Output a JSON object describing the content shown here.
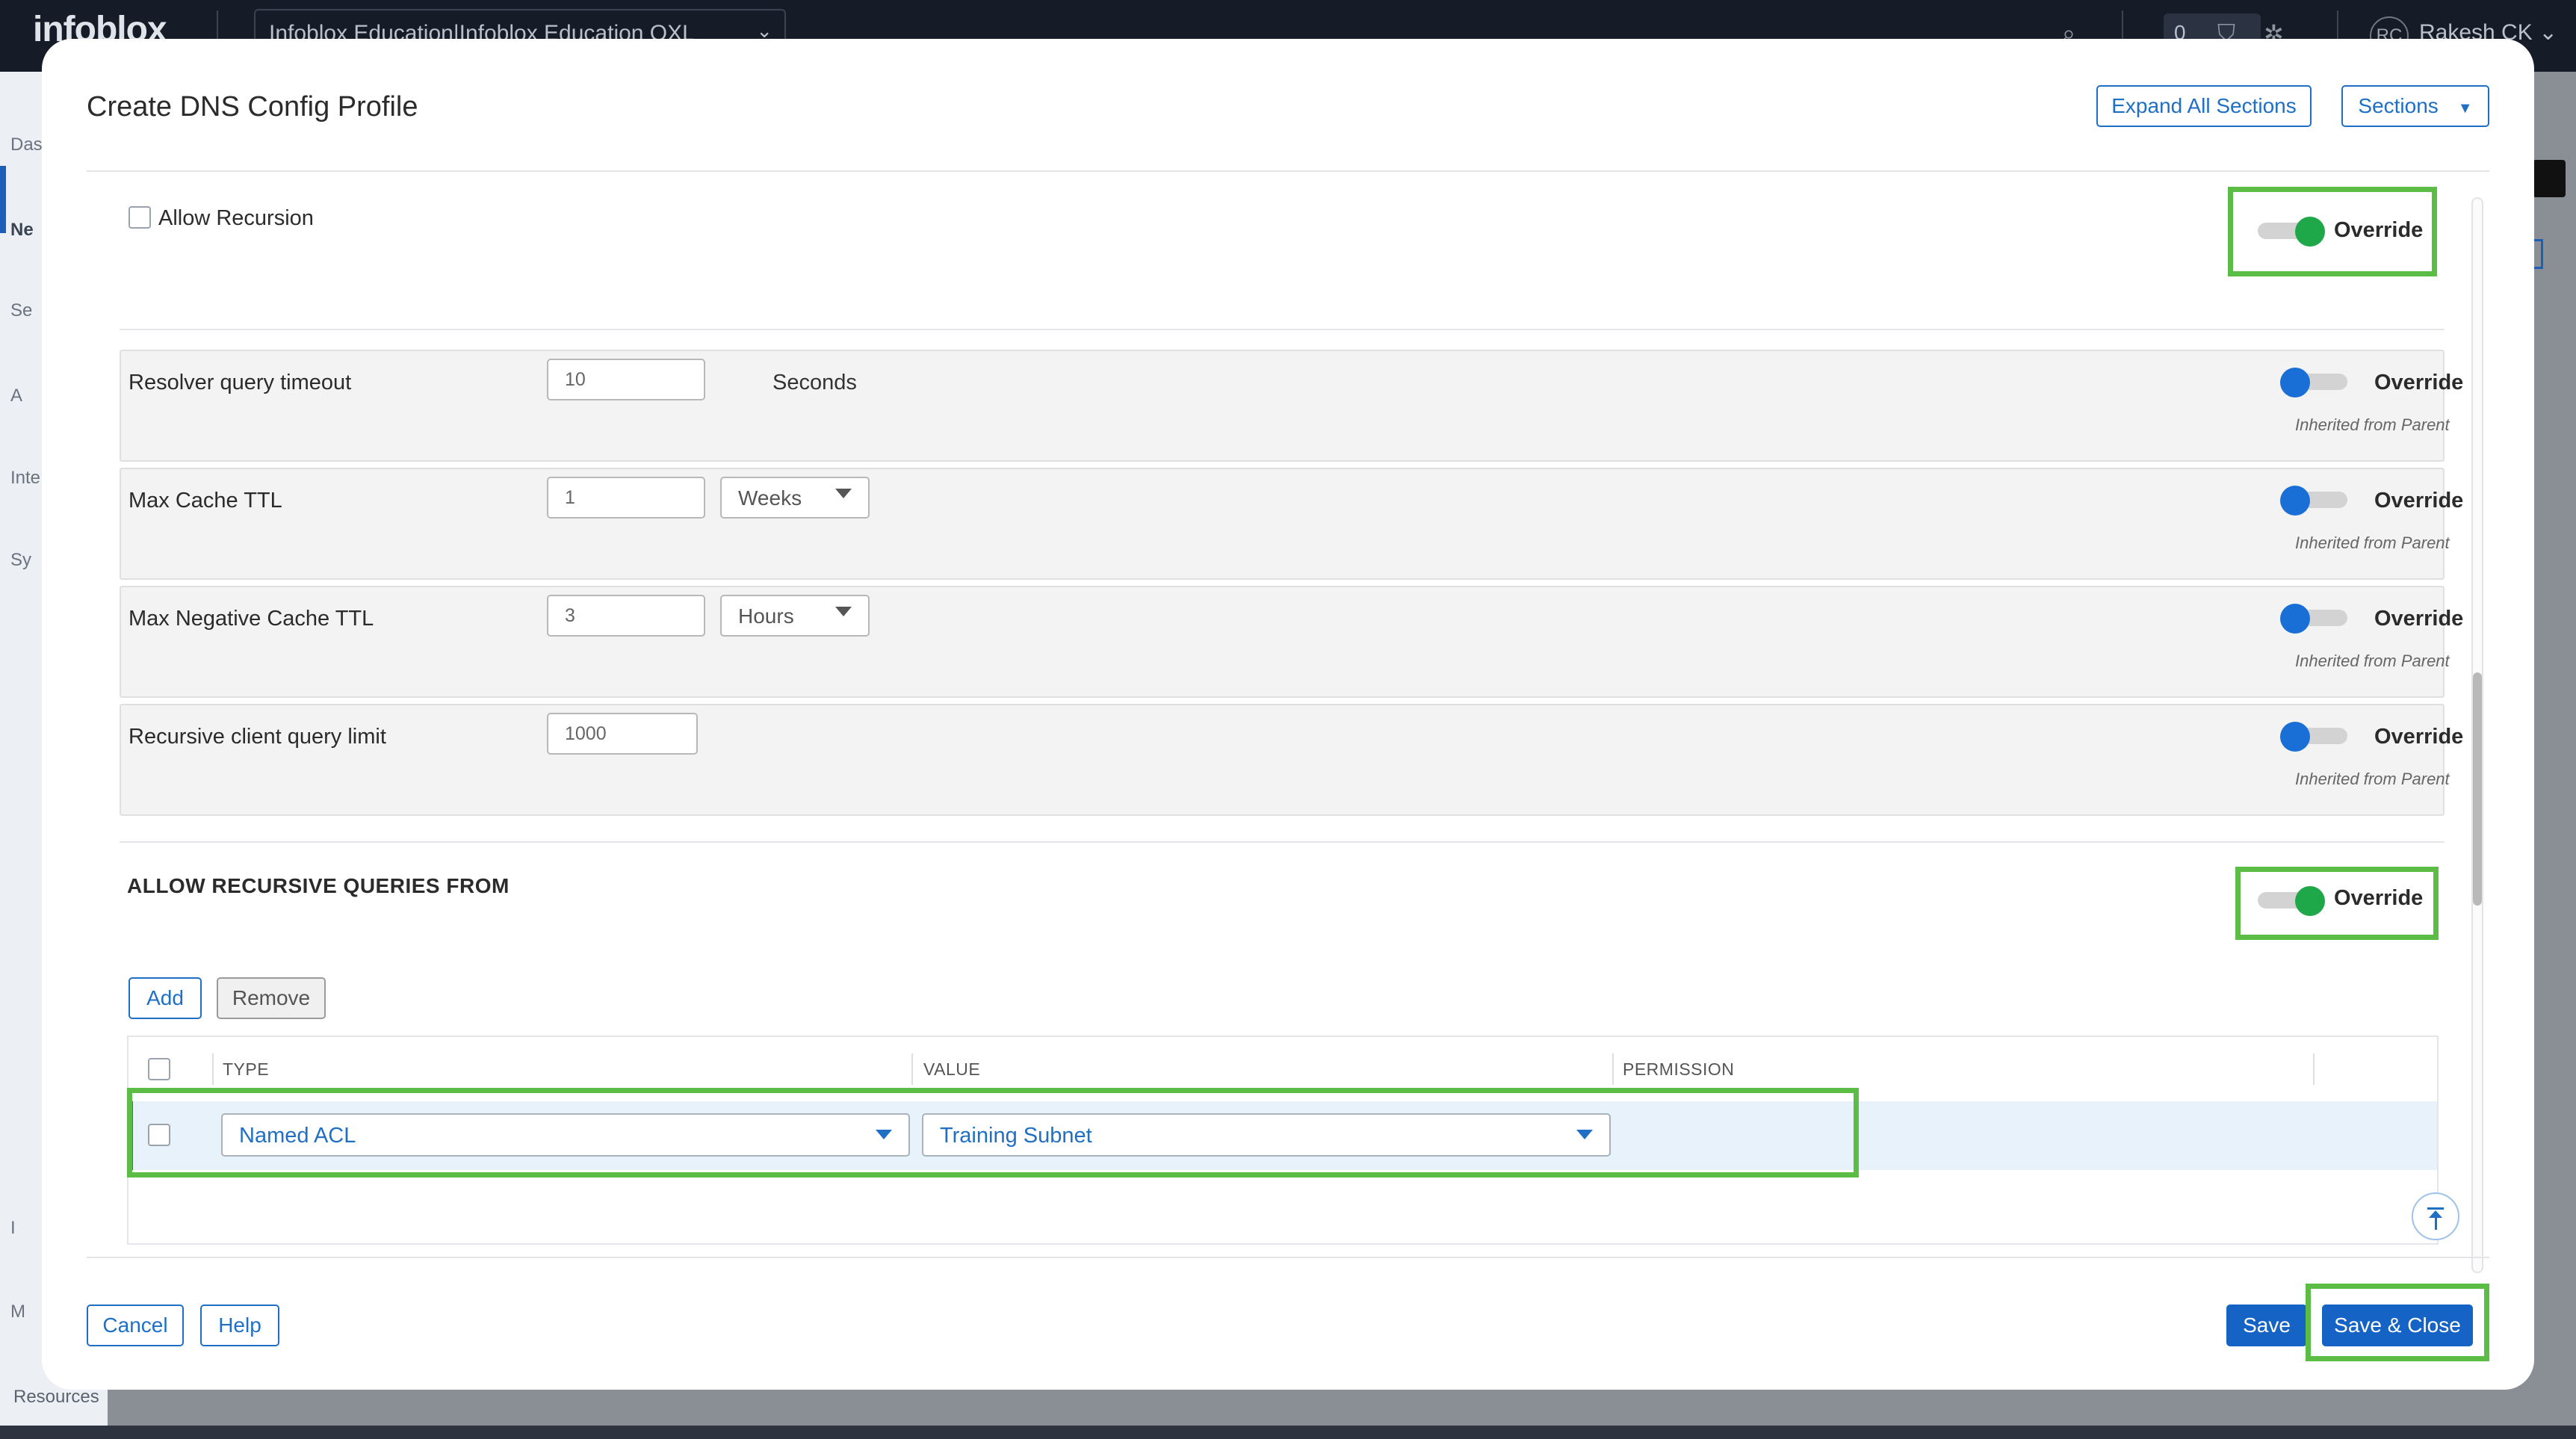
{
  "topbar": {
    "brand": "infoblox",
    "account": "Infoblox Education|Infoblox Education OXL",
    "notifications": "0",
    "user_initials": "RC",
    "user_name": "Rakesh CK"
  },
  "sidebar": {
    "items": [
      "Das",
      "Ne",
      "Se",
      "A",
      "Inte",
      "Sy",
      "I",
      "M"
    ],
    "resources": "Resources"
  },
  "modal": {
    "title": "Create DNS Config Profile",
    "expand_all": "Expand All Sections",
    "sections": "Sections",
    "allow_recursion": {
      "label": "Allow Recursion",
      "checked": false,
      "override": "Override",
      "override_on": true
    },
    "settings": [
      {
        "label": "Resolver query timeout",
        "value": "10",
        "unit": "Seconds",
        "override": "Override",
        "inherited": "Inherited from Parent"
      },
      {
        "label": "Max Cache TTL",
        "value": "1",
        "unit": "Weeks",
        "override": "Override",
        "inherited": "Inherited from Parent"
      },
      {
        "label": "Max Negative Cache TTL",
        "value": "3",
        "unit": "Hours",
        "override": "Override",
        "inherited": "Inherited from Parent"
      },
      {
        "label": "Recursive client query limit",
        "value": "1000",
        "override": "Override",
        "inherited": "Inherited from Parent"
      }
    ],
    "recursive_queries": {
      "heading": "ALLOW RECURSIVE QUERIES FROM",
      "override": "Override",
      "add": "Add",
      "remove": "Remove",
      "columns": [
        "TYPE",
        "VALUE",
        "PERMISSION"
      ],
      "rows": [
        {
          "type": "Named ACL",
          "value": "Training Subnet",
          "permission": ""
        }
      ]
    },
    "footer": {
      "cancel": "Cancel",
      "help": "Help",
      "save": "Save",
      "save_close": "Save & Close"
    }
  },
  "colors": {
    "accent": "#1f6fc5",
    "toggle_on": "#1fa84a",
    "toggle_off": "#1a6fd6",
    "highlight": "#5bbd46"
  }
}
